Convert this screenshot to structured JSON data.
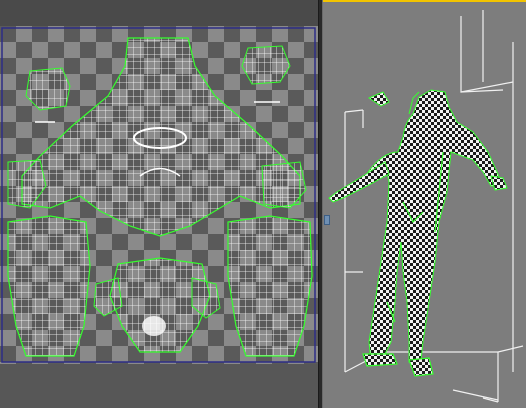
{
  "app": {
    "panels": [
      "uv-editor",
      "perspective-viewport"
    ]
  },
  "colors": {
    "uv_edge": "#ffffff",
    "uv_seam": "#36ff2e",
    "checker_light": "#8a8a8a",
    "checker_dark": "#5a5a5a",
    "viewport_bg": "#7d7d7d",
    "active_border": "#f2c400",
    "texture_frame": "#2c2c86",
    "grid": "#f0f0f0"
  },
  "uv_editor": {
    "checker_cells_per_row": 20,
    "islands": [
      "head-upper",
      "torso",
      "hand-left",
      "hand-right",
      "leg-left",
      "leg-right",
      "lower-head",
      "foot-left",
      "foot-right"
    ]
  },
  "viewport": {
    "view": "perspective",
    "model": "creature-checker-textured"
  }
}
